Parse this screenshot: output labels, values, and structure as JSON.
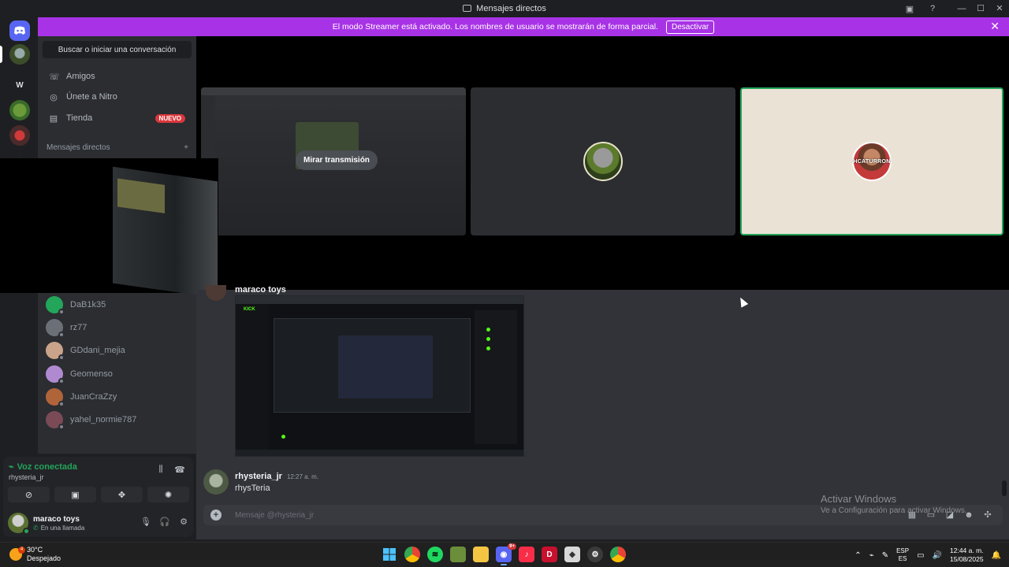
{
  "window": {
    "title": "Mensajes directos",
    "controls": [
      "—",
      "☐",
      "✕"
    ]
  },
  "banner": {
    "text": "El modo Streamer está activado. Los nombres de usuario se mostrarán de forma parcial.",
    "button": "Desactivar",
    "close": "✕"
  },
  "rail": {
    "servers": [
      {
        "name": "home",
        "letter": ""
      },
      {
        "name": "W",
        "letter": "W"
      }
    ]
  },
  "sidebar": {
    "search": "Buscar o iniciar una conversación",
    "nav": [
      {
        "label": "Amigos",
        "icon": "friends-icon"
      },
      {
        "label": "Únete a Nitro",
        "icon": "nitro-icon"
      },
      {
        "label": "Tienda",
        "icon": "shop-icon",
        "badge": "NUEVO"
      }
    ],
    "dm_header": "Mensajes directos",
    "dm_add": "+",
    "dms": [
      {
        "name": "DaB1k35",
        "color": "#23a55a"
      },
      {
        "name": "rz77",
        "color": "#6b6f78"
      },
      {
        "name": "GDdani_mejia",
        "color": "#c9a38a"
      },
      {
        "name": "Geomenso",
        "color": "#b08ad0"
      },
      {
        "name": "JuanCraZzy",
        "color": "#b0643a"
      },
      {
        "name": "yahel_normie787",
        "color": "#7a4a56"
      }
    ]
  },
  "stage": {
    "watch_button": "Mirar transmisión",
    "tile3_caption": "HCATURRON"
  },
  "chat": {
    "partial_author": "maraco toys",
    "message": {
      "author": "rhysteria_jr",
      "time": "12:27 a. m.",
      "text": "rhysTeria"
    },
    "composer_placeholder": "Mensaje @rhysteria_jr"
  },
  "activate_windows": {
    "line1": "Activar Windows",
    "line2": "Ve a Configuración para activar Windows."
  },
  "voice": {
    "status": "Voz conectada",
    "channel": "rhysteria_jr",
    "user": {
      "name": "maraco toys",
      "status": "En una llamada"
    }
  },
  "taskbar": {
    "weather_temp": "30°C",
    "weather_desc": "Despejado",
    "weather_badge": "4",
    "discord_badge": "9+",
    "lang_line1": "ESP",
    "lang_line2": "ES",
    "time": "12:44 a. m.",
    "date": "15/08/2025"
  }
}
